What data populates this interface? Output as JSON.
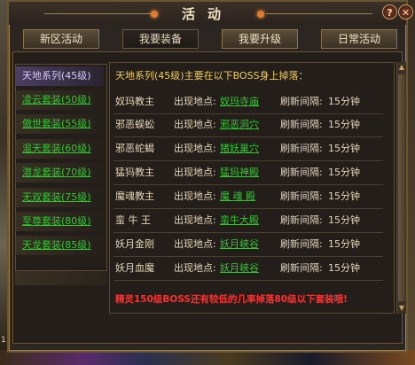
{
  "window": {
    "title": "活动"
  },
  "title_buttons": {
    "help": "?",
    "close": "✕"
  },
  "tabs": [
    {
      "label": "新区活动",
      "active": false
    },
    {
      "label": "我要装备",
      "active": true
    },
    {
      "label": "我要升级",
      "active": false
    },
    {
      "label": "日常活动",
      "active": false
    }
  ],
  "sidebar": {
    "items": [
      {
        "label": "天地系列(45级)",
        "selected": true
      },
      {
        "label": "凌云套装(50级)",
        "selected": false
      },
      {
        "label": "傲世套装(55级)",
        "selected": false
      },
      {
        "label": "混天套装(60级)",
        "selected": false
      },
      {
        "label": "潜龙套装(70级)",
        "selected": false
      },
      {
        "label": "无双套装(75级)",
        "selected": false
      },
      {
        "label": "至尊套装(80级)",
        "selected": false
      },
      {
        "label": "天龙套装(85级)",
        "selected": false
      }
    ]
  },
  "main": {
    "heading": "天地系列(45级)主要在以下BOSS身上掉落：",
    "location_label": "出现地点:",
    "refresh_label": "刷新间隔:",
    "bosses": [
      {
        "name": "奴玛教主",
        "location": "奴玛寺庙",
        "refresh": "15分钟"
      },
      {
        "name": "邪恶蜈蚣",
        "location": "邪恶洞穴",
        "refresh": "15分钟"
      },
      {
        "name": "邪恶蛇蝎",
        "location": "猪妖巢穴",
        "refresh": "15分钟"
      },
      {
        "name": "猛犸教主",
        "location": "猛犸神殿",
        "refresh": "15分钟"
      },
      {
        "name": "魔魂教主",
        "location": "魔 魂 殿",
        "refresh": "15分钟"
      },
      {
        "name": "蛮 牛 王",
        "location": "蛮牛大殿",
        "refresh": "15分钟"
      },
      {
        "name": "妖月金刚",
        "location": "妖月峡谷",
        "refresh": "15分钟"
      },
      {
        "name": "妖月血魔",
        "location": "妖月峡谷",
        "refresh": "15分钟"
      }
    ],
    "notice": "精灵150级BOSS还有较低的几率掉落80级以下套装哦!"
  },
  "footer": {
    "number": "1"
  },
  "colors": {
    "link_green": "#30c830",
    "heading_gold": "#f0ce60",
    "notice_red": "#ff3030",
    "selected_purple": "#d8c8ff"
  }
}
